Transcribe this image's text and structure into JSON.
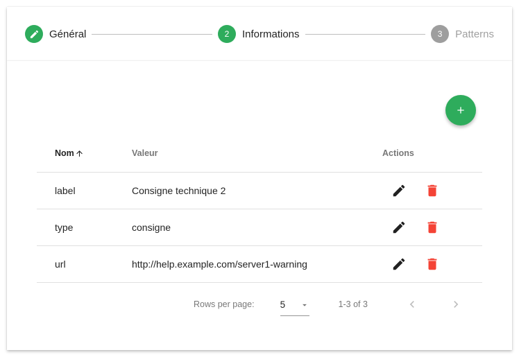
{
  "stepper": {
    "steps": [
      {
        "number": "",
        "label": "Général",
        "state": "done",
        "icon": "pencil-icon"
      },
      {
        "number": "2",
        "label": "Informations",
        "state": "active"
      },
      {
        "number": "3",
        "label": "Patterns",
        "state": "inactive"
      }
    ]
  },
  "colors": {
    "accent": "#2eac5c",
    "inactive_step": "#9e9e9e",
    "delete": "#f44336",
    "edit": "#212121"
  },
  "table": {
    "columns": {
      "name": "Nom",
      "value": "Valeur",
      "actions": "Actions"
    },
    "sort": {
      "column": "name",
      "direction": "asc",
      "icon": "arrow-up-icon"
    },
    "rows": [
      {
        "name": "label",
        "value": "Consigne technique 2"
      },
      {
        "name": "type",
        "value": "consigne"
      },
      {
        "name": "url",
        "value": "http://help.example.com/server1-warning"
      }
    ]
  },
  "fab": {
    "icon": "add-icon"
  },
  "pagination": {
    "rows_per_page_label": "Rows per page:",
    "rows_per_page_value": "5",
    "range_label": "1-3 of 3"
  }
}
